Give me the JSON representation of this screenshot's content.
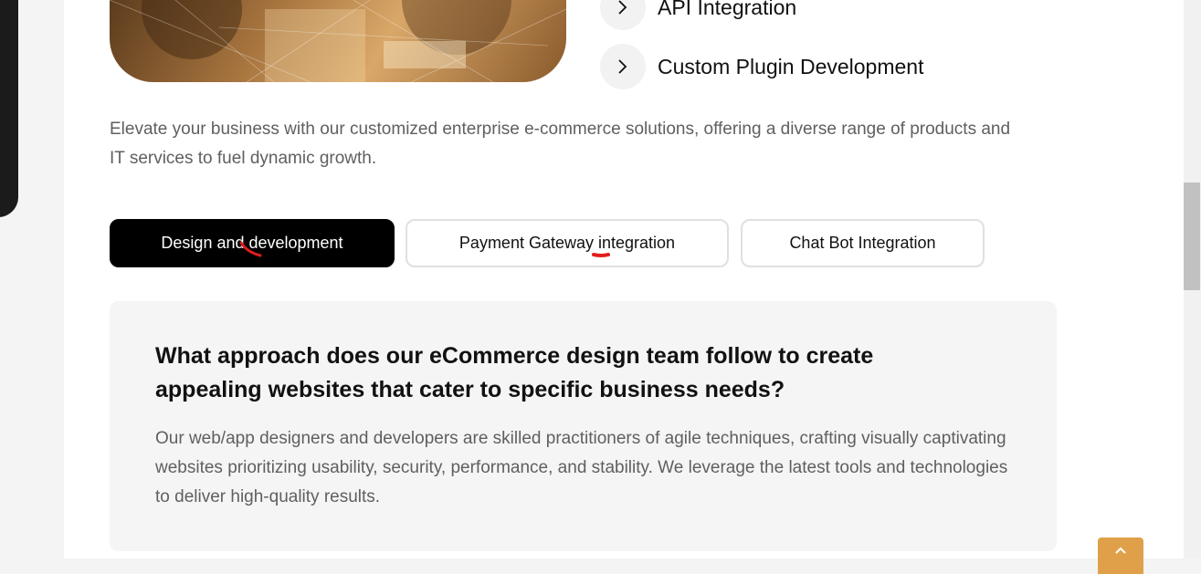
{
  "features": [
    {
      "label": "API Integration",
      "icon": "chevron-right-icon"
    },
    {
      "label": "Custom Plugin Development",
      "icon": "chevron-right-icon"
    }
  ],
  "intro_text": "Elevate your business with our customized enterprise e-commerce solutions, offering a diverse range of products and IT services to fuel dynamic growth.",
  "tabs": [
    {
      "label": "Design and development",
      "active": true
    },
    {
      "label": "Payment Gateway integration",
      "active": false
    },
    {
      "label": "Chat Bot Integration",
      "active": false
    }
  ],
  "faq": {
    "question": "What approach does our eCommerce design team follow to create appealing websites that cater to specific business needs?",
    "answer": "Our web/app designers and developers are skilled practitioners of agile techniques, crafting visually captivating websites prioritizing usability, security, performance, and stability. We leverage the latest tools and technologies to deliver high-quality results."
  },
  "colors": {
    "accent": "#e0a04a",
    "active_tab_bg": "#000000",
    "annotation_red": "#e11d1d"
  },
  "scroll_to_top_icon": "chevron-up-icon"
}
